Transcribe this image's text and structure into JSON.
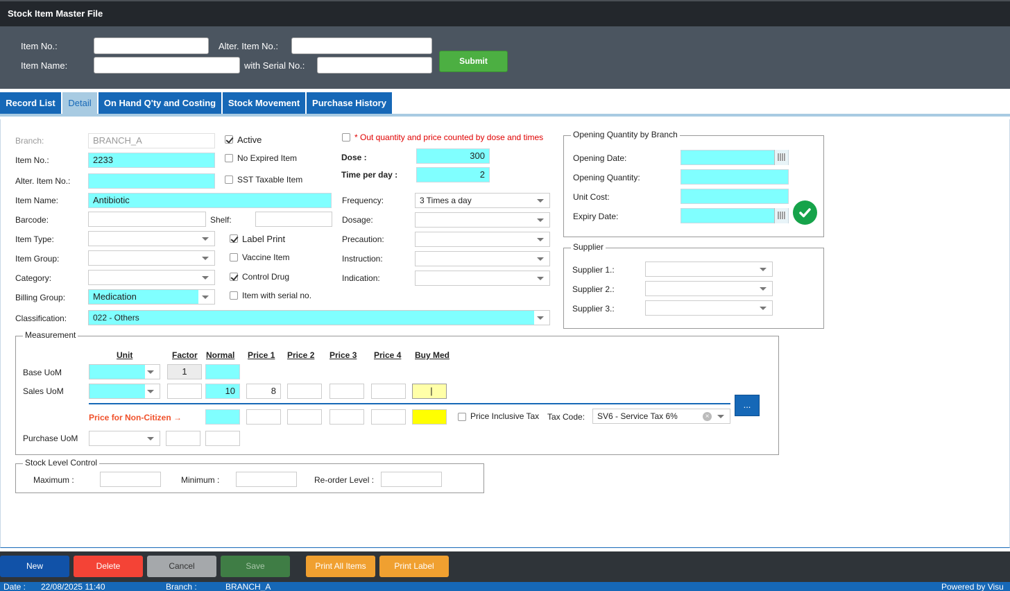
{
  "title": "Stock Item Master File",
  "search": {
    "item_no_label": "Item No.:",
    "alter_item_no_label": "Alter. Item No.:",
    "item_name_label": "Item Name:",
    "serial_label": "with Serial No.:",
    "submit_label": "Submit"
  },
  "tabs": [
    "Record List",
    "Detail",
    "On Hand Q'ty and Costing",
    "Stock Movement",
    "Purchase History"
  ],
  "form": {
    "branch_label": "Branch:",
    "branch_value": "BRANCH_A",
    "item_no_label": "Item No.:",
    "item_no_value": "2233",
    "alter_item_no_label": "Alter. Item No.:",
    "item_name_label": "Item Name:",
    "item_name_value": "Antibiotic",
    "barcode_label": "Barcode:",
    "shelf_label": "Shelf:",
    "item_type_label": "Item Type:",
    "item_group_label": "Item Group:",
    "category_label": "Category:",
    "billing_group_label": "Billing Group:",
    "billing_group_value": "Medication",
    "classification_label": "Classification:",
    "classification_value": "022 - Others"
  },
  "checks": {
    "active": "Active",
    "no_expired": "No Expired Item",
    "sst_taxable": "SST Taxable Item",
    "label_print": "Label Print",
    "vaccine": "Vaccine Item",
    "control_drug": "Control Drug",
    "serial_item": "Item with serial no."
  },
  "dose": {
    "note": "* Out quantity and price counted by dose and times",
    "dose_label": "Dose :",
    "dose_value": "300",
    "time_label": "Time per day :",
    "time_value": "2",
    "frequency_label": "Frequency:",
    "frequency_value": "3 Times a day",
    "dosage_label": "Dosage:",
    "precaution_label": "Precaution:",
    "instruction_label": "Instruction:",
    "indication_label": "Indication:"
  },
  "opening": {
    "legend": "Opening Quantity by Branch",
    "date_label": "Opening Date:",
    "qty_label": "Opening Quantity:",
    "cost_label": "Unit Cost:",
    "expiry_label": "Expiry Date:"
  },
  "supplier": {
    "legend": "Supplier",
    "s1": "Supplier 1.:",
    "s2": "Supplier 2.:",
    "s3": "Supplier 3.:"
  },
  "measurement": {
    "legend": "Measurement",
    "headers": [
      "Unit",
      "Factor",
      "Normal",
      "Price 1",
      "Price 2",
      "Price 3",
      "Price 4",
      "Buy Med"
    ],
    "base_uom": "Base UoM",
    "base_factor": "1",
    "sales_uom": "Sales UoM",
    "sales_normal": "10",
    "sales_price1": "8",
    "sales_buymed": "|",
    "non_citizen": "Price for Non-Citizen →",
    "price_inclusive": "Price Inclusive Tax",
    "tax_code_label": "Tax Code:",
    "tax_code_value": "SV6 - Service Tax 6%",
    "more_btn": "...",
    "purchase_uom": "Purchase UoM"
  },
  "stock_level": {
    "legend": "Stock Level Control",
    "max": "Maximum :",
    "min": "Minimum :",
    "reorder": "Re-order Level :"
  },
  "toolbar": {
    "new": "New",
    "delete": "Delete",
    "cancel": "Cancel",
    "save": "Save",
    "print_all": "Print All Items",
    "print_label": "Print Label"
  },
  "status": {
    "date_label": "Date :",
    "date_value": "22/08/2025 11:40",
    "branch_label": "Branch :",
    "branch_value": "BRANCH_A",
    "powered": "Powered by Visu"
  },
  "colors": {
    "tab_blue": "#1668b7",
    "cyan_field": "#80ffff",
    "green": "#4caf42",
    "danger": "#f44336"
  }
}
